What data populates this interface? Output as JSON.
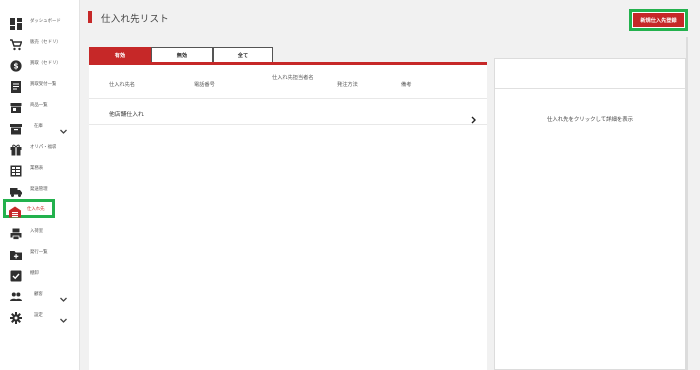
{
  "sidebar": {
    "items": [
      {
        "label": "ダッシュボード",
        "icon": "dashboard-icon"
      },
      {
        "label": "販売（セドリ）",
        "icon": "cart-icon"
      },
      {
        "label": "買取（セドリ）",
        "icon": "dollar-icon"
      },
      {
        "label": "買取受付一覧",
        "icon": "receipt-list-icon"
      },
      {
        "label": "商品一覧",
        "icon": "storefront-icon"
      },
      {
        "label": "在庫",
        "icon": "inventory-box-icon"
      },
      {
        "label": "オリパ・福袋",
        "icon": "gift-icon"
      },
      {
        "label": "業務表",
        "icon": "table-icon"
      },
      {
        "label": "発送管理",
        "icon": "truck-icon"
      },
      {
        "label": "仕入れ先",
        "icon": "warehouse-icon"
      },
      {
        "label": "入荷室",
        "icon": "printer-icon"
      },
      {
        "label": "発行一覧",
        "icon": "folder-add-icon"
      },
      {
        "label": "棚卸",
        "icon": "check-square-icon"
      },
      {
        "label": "顧客",
        "icon": "people-icon"
      },
      {
        "label": "設定",
        "icon": "gear-icon"
      }
    ]
  },
  "header": {
    "title": "仕入れ先リスト",
    "register_label": "新規仕入先登録"
  },
  "tabs": [
    "有効",
    "無効",
    "全て"
  ],
  "table": {
    "columns": [
      "仕入れ先名",
      "電話番号",
      "仕入れ先担当者名",
      "発注方法",
      "備考"
    ],
    "rows": [
      {
        "name": "他店舗仕入れ",
        "phone": "",
        "contact": "",
        "method": "",
        "note": ""
      }
    ]
  },
  "detail": {
    "placeholder": "仕入れ先をクリックして詳細を表示"
  },
  "colors": {
    "accent": "#c62828",
    "highlight": "#23b14d",
    "sidebar_icon": "#2f2f2f"
  }
}
